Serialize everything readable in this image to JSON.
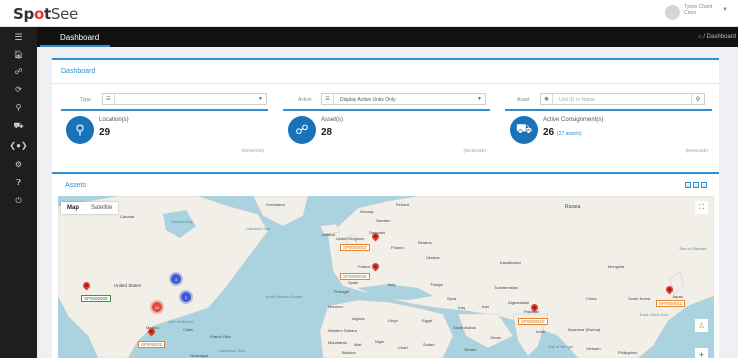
{
  "brand": {
    "logo_left": "Sp",
    "logo_accent": "o",
    "logo_mid": "t",
    "logo_rest": "See"
  },
  "user": {
    "name": "Tyson Chard",
    "role": "Ctars"
  },
  "header": {
    "title": "Dashboard",
    "breadcrumb": "/ Dashboard"
  },
  "sidebar": {
    "icons": [
      "menu-icon",
      "home-icon",
      "network-icon",
      "refresh-icon",
      "location-icon",
      "truck-icon",
      "signal-icon",
      "settings-icon",
      "help-icon",
      "power-icon"
    ]
  },
  "panel": {
    "title": "Dashboard"
  },
  "filters": {
    "type_label": "Type",
    "type_value": "",
    "active_label": "Active",
    "active_value": "Display Active Units Only",
    "asset_label": "Asset",
    "asset_placeholder": "Unit ID or Name"
  },
  "cards": [
    {
      "label": "Location(s)",
      "value": "29",
      "sub": "",
      "manage": "(MANAGE)",
      "icon": "map-pin-icon"
    },
    {
      "label": "Asset(s)",
      "value": "28",
      "sub": "",
      "manage": "(MANAGE)",
      "icon": "network-icon"
    },
    {
      "label": "Active Consignment(s)",
      "value": "26",
      "sub": "(27 assets)",
      "manage": "(MANAGE)",
      "icon": "truck-icon"
    }
  ],
  "assets": {
    "title": "Assets"
  },
  "map": {
    "tab_map": "Map",
    "tab_satellite": "Satellite",
    "clusters": [
      "3",
      "2",
      "10"
    ],
    "markers": [
      "SP0000009",
      "SP0000003",
      "SP0000005",
      "SP0000010",
      "SP0000011",
      "SP000022"
    ],
    "places": {
      "canada": "Canada",
      "hudson": "Hudson Bay",
      "labrador": "Labrador Sea",
      "greenland": "Greenland",
      "iceland": "Iceland",
      "norway": "Norway",
      "sweden": "Sweden",
      "finland": "Finland",
      "russia": "Russia",
      "uk": "United Kingdom",
      "denmark": "Denmark",
      "belarus": "Belarus",
      "poland": "Poland",
      "ukraine": "Ukraine",
      "kazakhstan": "Kazakhstan",
      "mongolia": "Mongolia",
      "france": "France",
      "spain": "Spain",
      "portugal": "Portugal",
      "italy": "Italy",
      "turkey": "Türkiye",
      "turkmenistan": "Turkmenistan",
      "us": "United States",
      "mexico": "Mexico",
      "gulf": "Gulf of Mexico",
      "cuba": "Cuba",
      "puerto_rico": "Puerto Rico",
      "north_atlantic": "North Atlantic Ocean",
      "morocco": "Morocco",
      "algeria": "Algeria",
      "libya": "Libya",
      "egypt": "Egypt",
      "saudi": "Saudi Arabia",
      "iran": "Iran",
      "iraq": "Iraq",
      "syria": "Syria",
      "afghanistan": "Afghanistan",
      "pakistan": "Pakistan",
      "india": "India",
      "china": "China",
      "south_korea": "South Korea",
      "japan": "Japan",
      "sea_okhotsk": "Sea of Okhotsk",
      "western_sahara": "Western Sahara",
      "mauritania": "Mauritania",
      "mali": "Mali",
      "niger": "Niger",
      "chad": "Chad",
      "sudan": "Sudan",
      "burkina": "Burkina",
      "oman": "Oman",
      "yemen": "Yemen",
      "myanmar": "Myanmar (Burma)",
      "bay_bengal": "Bay of Bengal",
      "vietnam": "Vietnam",
      "philippines": "Philippines",
      "east_china_sea": "East China Sea",
      "caribbean": "Caribbean Sea",
      "nicaragua": "Nicaragua"
    }
  }
}
